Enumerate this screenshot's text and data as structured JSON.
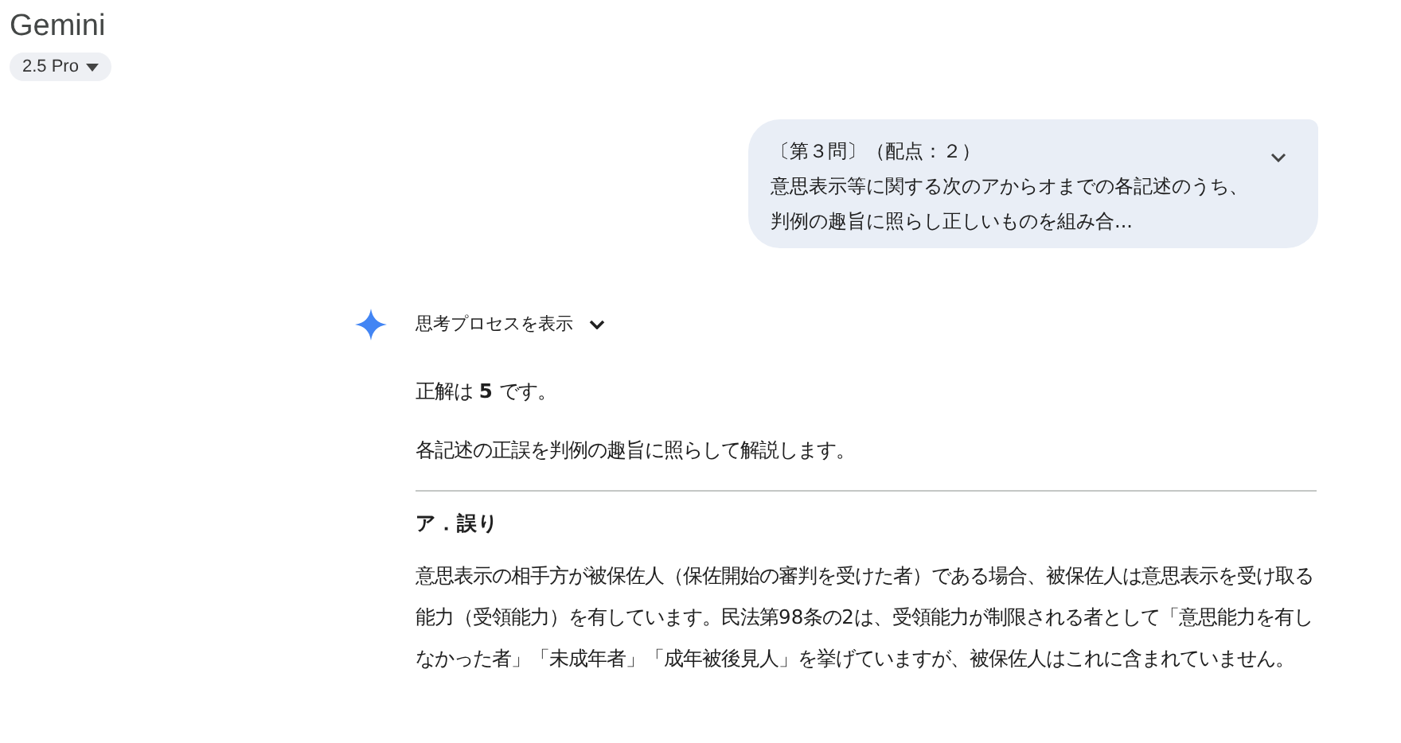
{
  "app": {
    "title": "Gemini",
    "model": "2.5 Pro"
  },
  "prompt": {
    "lines": [
      "〔第３問〕（配点：２）",
      "意思表示等に関する次のアからオまでの各記述のうち、",
      "判例の趣旨に照らし正しいものを組み合..."
    ],
    "expanded": false
  },
  "response": {
    "thinking_label": "思考プロセスを表示",
    "thinking_expanded": false,
    "paragraphs": [
      {
        "kind": "text",
        "text": "正解は **5** です。"
      },
      {
        "kind": "text",
        "text": "各記述の正誤を判例の趣旨に照らして解説します。"
      },
      {
        "kind": "rule"
      },
      {
        "kind": "heading",
        "text": "ア．誤り"
      },
      {
        "kind": "text",
        "text": "意思表示の相手方が被保佐人（保佐開始の審判を受けた者）である場合、被保佐人は意思表示を受け取る能力（受領能力）を有しています。民法第98条の2は、受領能力が制限される者として「意思能力を有しなかった者」「未成年者」「成年被後見人」を挙げていますが、被保佐人はこれに含まれていません。"
      }
    ]
  }
}
